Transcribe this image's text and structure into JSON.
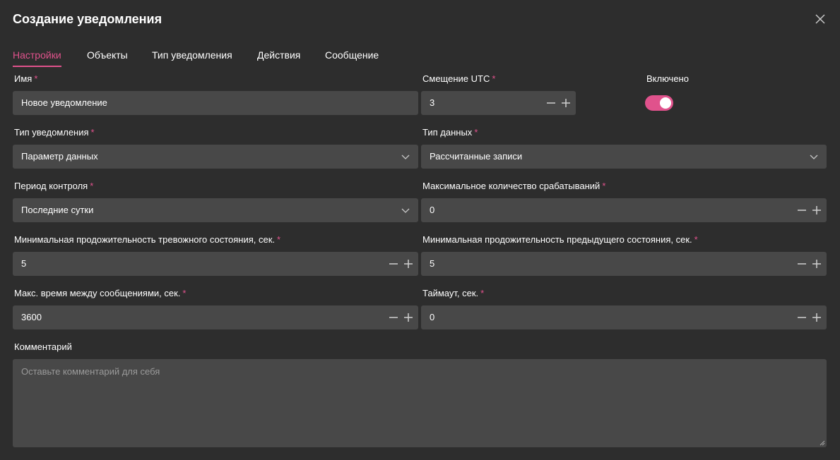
{
  "dialog": {
    "title": "Создание уведомления",
    "close_icon": "close-icon"
  },
  "tabs": [
    {
      "label": "Настройки",
      "active": true
    },
    {
      "label": "Объекты",
      "active": false
    },
    {
      "label": "Тип уведомления",
      "active": false
    },
    {
      "label": "Действия",
      "active": false
    },
    {
      "label": "Сообщение",
      "active": false
    }
  ],
  "form": {
    "name": {
      "label": "Имя",
      "required": "*",
      "value": "Новое уведомление"
    },
    "utc_offset": {
      "label": "Смещение UTC",
      "required": "*",
      "value": "3"
    },
    "enabled": {
      "label": "Включено",
      "value": true
    },
    "notification_type": {
      "label": "Тип уведомления",
      "required": "*",
      "value": "Параметр данных"
    },
    "data_type": {
      "label": "Тип данных",
      "required": "*",
      "value": "Рассчитанные записи"
    },
    "control_period": {
      "label": "Период контроля",
      "required": "*",
      "value": "Последние сутки"
    },
    "max_triggers": {
      "label": "Максимальное количество срабатываний",
      "required": "*",
      "value": "0"
    },
    "min_alarm_duration": {
      "label": "Минимальная продожительность тревожного состояния, сек.",
      "required": "*",
      "value": "5"
    },
    "min_prev_duration": {
      "label": "Минимальная продожительность предыдущего состояния, сек.",
      "required": "*",
      "value": "5"
    },
    "max_msg_interval": {
      "label": "Макс. время между сообщениями, сек.",
      "required": "*",
      "value": "3600"
    },
    "timeout": {
      "label": "Таймаут, сек.",
      "required": "*",
      "value": "0"
    },
    "comment": {
      "label": "Комментарий",
      "placeholder": "Оставьте комментарий для себя"
    }
  },
  "colors": {
    "accent": "#e0528c",
    "background": "#2d2d2d",
    "field": "#484848"
  }
}
